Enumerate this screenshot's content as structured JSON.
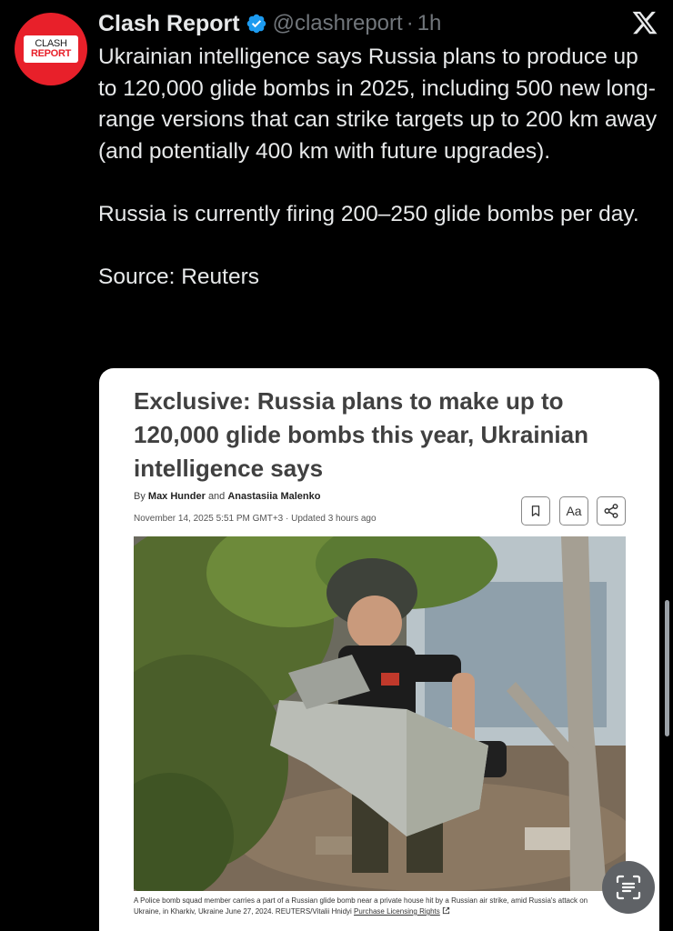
{
  "author": {
    "name": "Clash Report",
    "handle": "@clashreport",
    "separator": "·",
    "time": "1h",
    "avatar_line1": "CLASH",
    "avatar_line2": "REPORT"
  },
  "icons": {
    "verified": "verified-badge-icon",
    "platform": "x-logo-icon",
    "bookmark": "bookmark-icon",
    "share": "share-icon",
    "text_size_label": "Aa",
    "scan": "text-scan-icon",
    "external": "external-link-icon"
  },
  "tweet": {
    "paragraph1": "Ukrainian intelligence says Russia plans to produce up to 120,000 glide bombs in 2025, including 500 new long-range versions that can strike targets up to 200 km away (and potentially 400 km with future upgrades).",
    "paragraph2": "Russia is currently firing 200–250 glide bombs per day.",
    "paragraph3": "Source: Reuters"
  },
  "article": {
    "headline": "Exclusive: Russia plans to make up to 120,000 glide bombs this year, Ukrainian intelligence says",
    "by": "By",
    "author1": "Max Hunder",
    "and": "and",
    "author2": "Anastasiia Malenko",
    "dateline": "November 14, 2025 5:51 PM GMT+3 · Updated 3 hours ago",
    "caption": "A Police bomb squad member carries a part of a Russian glide bomb near a private house hit by a Russian air strike, amid Russia's attack on Ukraine, in Kharkiv, Ukraine June 27, 2024. REUTERS/Vitalii Hnidyi",
    "license_link": "Purchase Licensing Rights"
  },
  "colors": {
    "background": "#000000",
    "text": "#e7e9ea",
    "muted": "#71767b",
    "verified": "#1d9bf0",
    "brand_red": "#e8202a"
  }
}
